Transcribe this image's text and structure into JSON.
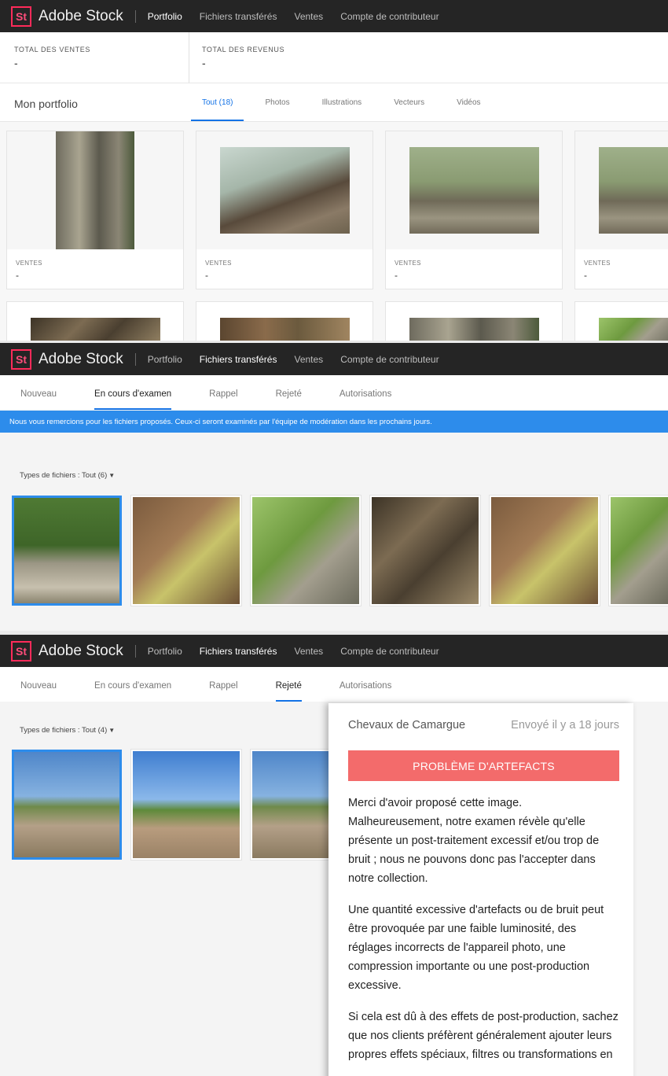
{
  "app": {
    "logo": "St",
    "brand": "Adobe Stock"
  },
  "nav": [
    "Portfolio",
    "Fichiers transférés",
    "Ventes",
    "Compte de contributeur"
  ],
  "stats": [
    {
      "label": "TOTAL DES VENTES",
      "value": "-"
    },
    {
      "label": "TOTAL DES REVENUS",
      "value": "-"
    }
  ],
  "portfolio": {
    "title": "Mon portfolio",
    "tabs": [
      "Tout (18)",
      "Photos",
      "Illustrations",
      "Vecteurs",
      "Vidéos"
    ],
    "card_label": "VENTES",
    "card_value": "-"
  },
  "review_tabs": [
    "Nouveau",
    "En cours d'examen",
    "Rappel",
    "Rejeté",
    "Autorisations"
  ],
  "review": {
    "banner": "Nous vous remercions pour les fichiers proposés. Ceux-ci seront examinés par l'équipe de modération dans les prochains jours.",
    "filter": "Types de fichiers : Tout (6)",
    "chevron": "chevron-down-icon"
  },
  "rejected": {
    "filter": "Types de fichiers : Tout (4)",
    "detail": {
      "title": "Chevaux de Camargue",
      "sent": "Envoyé il y a 18 jours",
      "reason": "PROBLÈME D'ARTEFACTS",
      "paragraphs": [
        "Merci d'avoir proposé cette image. Malheureusement, notre examen révèle qu'elle présente un post-traitement excessif et/ou trop de bruit ; nous ne pouvons donc pas l'accepter dans notre collection.",
        "Une quantité excessive d'artefacts ou de bruit peut être provoquée par une faible luminosité, des réglages incorrects de l'appareil photo, une compression importante ou une post-production excessive.",
        "Si cela est dû à des effets de post-production, sachez que nos clients préfèrent généralement ajouter leurs propres effets spéciaux, filtres ou transformations en"
      ]
    }
  },
  "colors": {
    "accent": "#1473e6",
    "banner": "#2d8ceb",
    "reject": "#f36b6b",
    "topbar": "#252525",
    "logo": "#ff2b5a"
  }
}
